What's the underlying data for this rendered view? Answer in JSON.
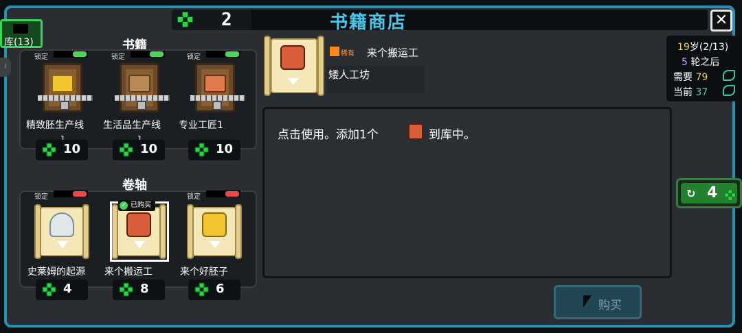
{
  "header": {
    "gem_count": "2",
    "shop_title": "书籍商店",
    "close_symbol": "✕"
  },
  "library": {
    "label": "库(13)"
  },
  "side_knob_symbol": "⁞",
  "books": {
    "heading": "书籍",
    "items": [
      {
        "lock": "锁定",
        "lock_state": "green",
        "name": "精致胚生产线",
        "stock": "1",
        "price": "10",
        "art": "gold"
      },
      {
        "lock": "锁定",
        "lock_state": "green",
        "name": "生活品生产线",
        "stock": "1",
        "price": "10",
        "art": "wood"
      },
      {
        "lock": "锁定",
        "lock_state": "green",
        "name": "专业工匠1",
        "stock": "",
        "price": "10",
        "art": "face"
      }
    ]
  },
  "scrolls": {
    "heading": "卷轴",
    "items": [
      {
        "lock": "锁定",
        "lock_state": "red",
        "name": "史莱姆的起源",
        "price": "4",
        "art": "slime"
      },
      {
        "lock": "",
        "lock_state": "",
        "name": "来个搬运工",
        "price": "8",
        "art": "dwarf",
        "badge": "已购买",
        "selected": true
      },
      {
        "lock": "锁定",
        "lock_state": "red",
        "name": "来个好胚子",
        "price": "6",
        "art": "chest-art"
      }
    ]
  },
  "detail": {
    "rarity": "稀有",
    "rarity_color": "#ff8a1a",
    "name": "来个搬运工",
    "source": "矮人工坊",
    "desc_before": "点击使用。添加1个",
    "desc_after": "到库中。"
  },
  "round_info": {
    "age": "19",
    "age_suffix": "岁(2/13)",
    "rounds": "5",
    "rounds_suffix": "轮之后",
    "need_label": "需要",
    "need_value": "79",
    "current_label": "当前",
    "current_value": "37"
  },
  "refresh": {
    "icon": "↻",
    "count": "4"
  },
  "buy": {
    "label": "购买"
  },
  "colors": {
    "accent": "#2a8fb0",
    "gem": "#2fd34a",
    "title": "#49c6ea"
  }
}
